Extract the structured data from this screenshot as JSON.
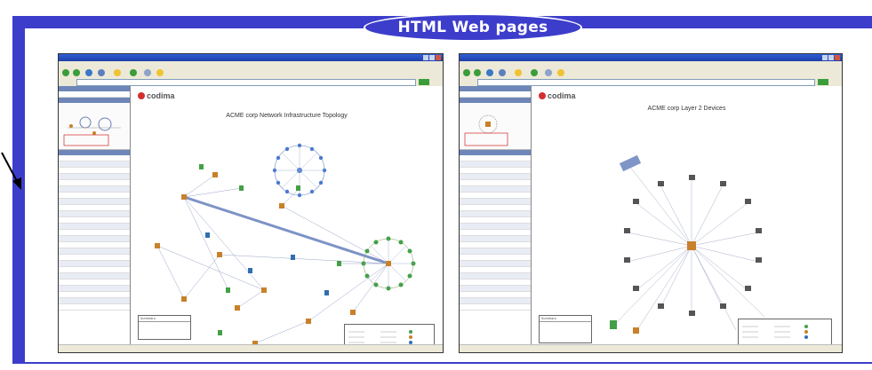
{
  "banner": {
    "title": "HTML Web pages"
  },
  "colors": {
    "frame": "#3d3dcc",
    "banner_text": "#ffffff",
    "brand_red": "#d32f2f",
    "node_orange": "#c8812a",
    "node_green": "#4caf50",
    "node_blue": "#2f6fb0"
  },
  "screenshots": [
    {
      "brand": "codima",
      "diagram_title": "ACME corp Network Infrastructure Topology",
      "diagram_subtitle": "",
      "summary_label": "Summary",
      "icons": [
        "back-icon",
        "forward-icon",
        "refresh-icon",
        "search-icon",
        "favorites-icon",
        "go-icon"
      ]
    },
    {
      "brand": "codima",
      "diagram_title": "ACME corp Layer 2 Devices",
      "diagram_subtitle": "",
      "summary_label": "Summary",
      "icons": [
        "back-icon",
        "forward-icon",
        "refresh-icon",
        "search-icon",
        "favorites-icon",
        "go-icon"
      ]
    }
  ]
}
